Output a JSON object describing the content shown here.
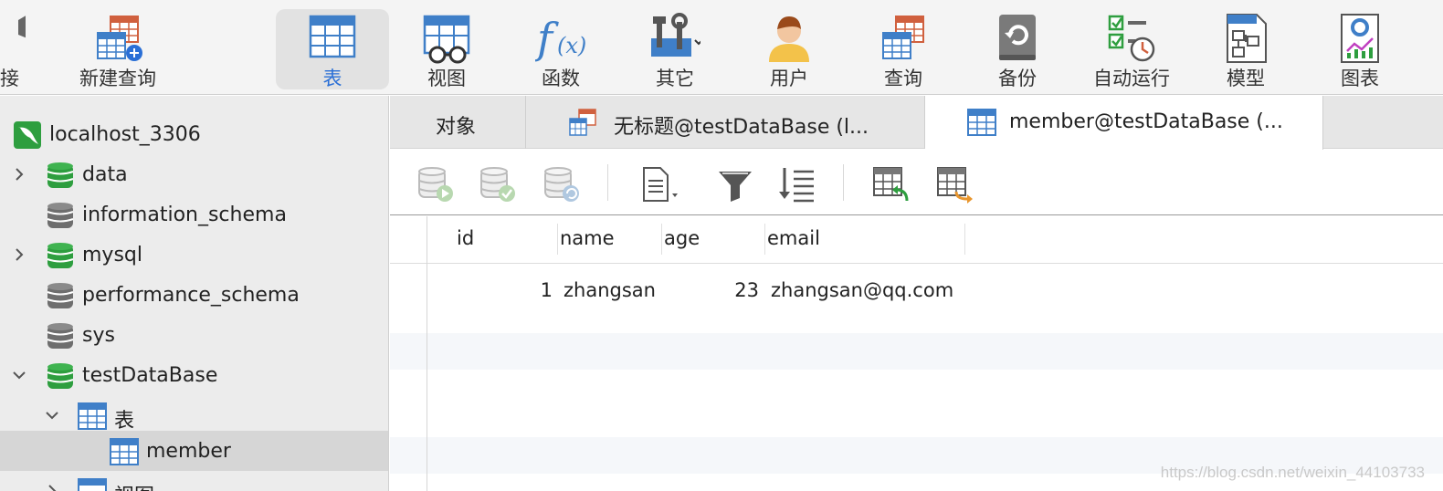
{
  "toolbar": {
    "items": [
      {
        "label": "连接",
        "icon": "connection-icon"
      },
      {
        "label": "新建查询",
        "icon": "new-query-icon"
      },
      {
        "label": "表",
        "icon": "table-icon",
        "active": true
      },
      {
        "label": "视图",
        "icon": "view-icon"
      },
      {
        "label": "函数",
        "icon": "function-icon"
      },
      {
        "label": "其它",
        "icon": "tools-icon"
      },
      {
        "label": "用户",
        "icon": "user-icon"
      },
      {
        "label": "查询",
        "icon": "query-icon"
      },
      {
        "label": "备份",
        "icon": "backup-icon"
      },
      {
        "label": "自动运行",
        "icon": "auto-run-icon"
      },
      {
        "label": "模型",
        "icon": "model-icon"
      },
      {
        "label": "图表",
        "icon": "chart-icon"
      }
    ]
  },
  "sidebar": {
    "connection": "localhost_3306",
    "databases": [
      "data",
      "information_schema",
      "mysql",
      "performance_schema",
      "sys",
      "testDataBase"
    ],
    "tables_folder": "表",
    "selected_table": "member",
    "views_folder": "视图"
  },
  "tabs": [
    {
      "label": "对象"
    },
    {
      "label": "无标题@testDataBase (l..."
    },
    {
      "label": "member@testDataBase (...",
      "active": true
    }
  ],
  "grid": {
    "columns": [
      "id",
      "name",
      "age",
      "email"
    ],
    "rows": [
      {
        "id": "1",
        "name": "zhangsan",
        "age": "23",
        "email": "zhangsan@qq.com"
      }
    ]
  },
  "watermark": "https://blog.csdn.net/weixin_44103733",
  "colors": {
    "accent": "#2a6fd6",
    "db_green": "#2e9e3f",
    "db_gray": "#6e6e6e",
    "table_blue": "#3f7fc8"
  }
}
